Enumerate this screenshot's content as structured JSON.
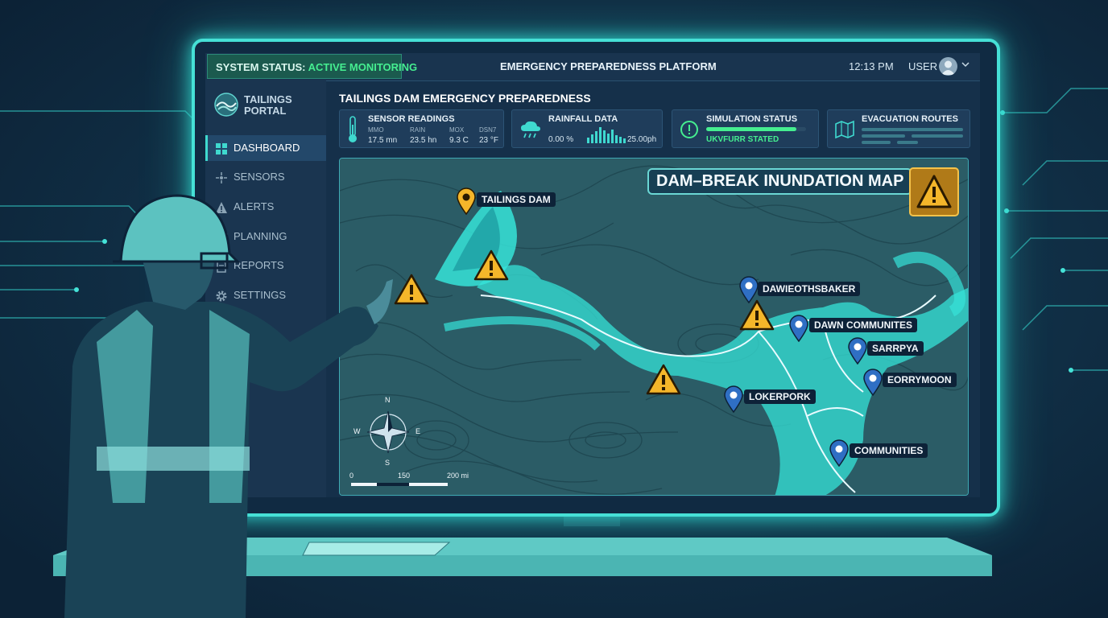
{
  "topbar": {
    "status_prefix": "SYSTEM STATUS: ",
    "status_value": "ACTIVE MONITORING",
    "platform_title": "EMERGENCY PREPAREDNESS PLATFORM",
    "time": "12:13 PM",
    "user_label": "USER"
  },
  "sidebar": {
    "logo_text": "TAILINGS PORTAL",
    "items": [
      {
        "label": "DASHBOARD",
        "icon": "grid-icon",
        "active": true
      },
      {
        "label": "SENSORS",
        "icon": "sensor-icon",
        "active": false
      },
      {
        "label": "ALERTS",
        "icon": "alert-triangle-icon",
        "active": false
      },
      {
        "label": "PLANNING",
        "icon": "calendar-icon",
        "active": false
      },
      {
        "label": "REPORTS",
        "icon": "document-icon",
        "active": false
      },
      {
        "label": "SETTINGS",
        "icon": "gear-icon",
        "active": false
      }
    ]
  },
  "main": {
    "title": "TAILINGS DAM EMERGENCY PREPAREDNESS",
    "cards": {
      "sensor": {
        "title": "SENSOR READINGS",
        "labels": [
          "MMO",
          "RAIN",
          "MOX",
          "DSN7"
        ],
        "values": [
          "17.5 mn",
          "23.5 hn",
          "9.3 C",
          "23 °F"
        ]
      },
      "rainfall": {
        "title": "RAINFALL DATA",
        "left_value": "0.00 %",
        "right_value": "25.00ph",
        "bars": [
          0.35,
          0.55,
          0.75,
          1.0,
          0.8,
          0.6,
          0.85,
          0.5,
          0.4,
          0.3
        ]
      },
      "simulation": {
        "title": "SIMULATION STATUS",
        "status": "UKVFURR STATED",
        "progress": 0.9
      },
      "evacuation": {
        "title": "EVACUATION ROUTES"
      }
    },
    "map": {
      "title": "DAM–BREAK INUNDATION MAP",
      "labels": {
        "dam": "TAILINGS DAM",
        "loc1": "DAWIEOTHSBAKER",
        "loc2": "DAWN COMMUNITES",
        "loc3": "SARRPYA",
        "loc4": "EORRYMOON",
        "loc5": "LOKERPORK",
        "loc6": "COMMUNITIES"
      },
      "compass": {
        "n": "N",
        "s": "S",
        "e": "E",
        "w": "W"
      },
      "scale": {
        "t0": "0",
        "t1": "150",
        "t2": "200 mi"
      }
    }
  },
  "colors": {
    "accent": "#3fd9cf",
    "status_green": "#45ee90",
    "warning": "#f4b62a",
    "pin": "#2f6fc4",
    "flood": "#36e3d8"
  }
}
